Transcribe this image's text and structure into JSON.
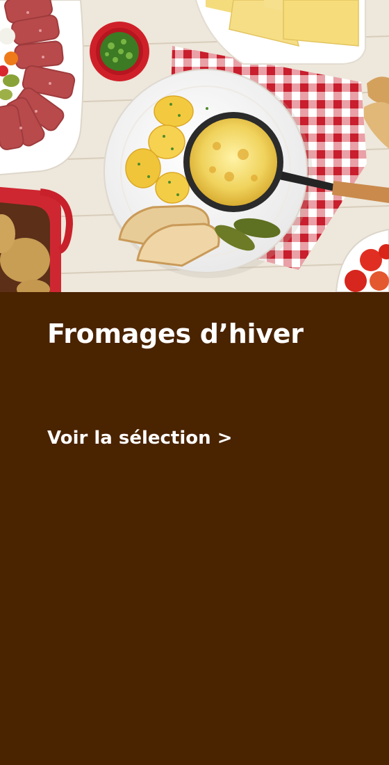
{
  "banner": {
    "title": "Fromages d’hiver",
    "cta_label": "Voir la sélection >",
    "background_color": "#4a2300",
    "text_color": "#ffffff"
  },
  "hero_image": {
    "subject": "raclette-cheese-dish-icon"
  }
}
